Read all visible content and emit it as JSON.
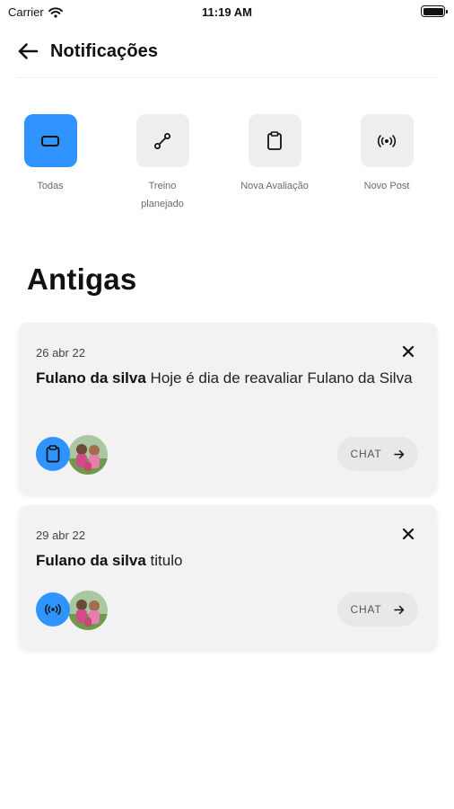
{
  "status_bar": {
    "carrier": "Carrier",
    "time": "11:19 AM"
  },
  "header": {
    "title": "Notificações",
    "back_icon": "arrow-left-icon"
  },
  "filters": [
    {
      "label": "Todas",
      "icon": "rectangle-icon",
      "active": true
    },
    {
      "label": "Treino planejado",
      "icon": "dumbbell-icon",
      "active": false
    },
    {
      "label": "Nova Avaliação",
      "icon": "clipboard-icon",
      "active": false
    },
    {
      "label": "Novo Post",
      "icon": "broadcast-icon",
      "active": false
    }
  ],
  "section": {
    "title": "Antigas"
  },
  "notifications": [
    {
      "date": "26 abr 22",
      "author": "Fulano da silva",
      "message": " Hoje é dia de reavaliar Fulano da Silva",
      "type_icon": "clipboard-icon",
      "chat_label": "CHAT"
    },
    {
      "date": "29 abr 22",
      "author": "Fulano da silva",
      "message": " titulo",
      "type_icon": "broadcast-icon",
      "chat_label": "CHAT"
    }
  ],
  "colors": {
    "accent": "#2f94ff",
    "card_bg": "#f2f2f2",
    "filter_bg": "#eeeeee"
  }
}
